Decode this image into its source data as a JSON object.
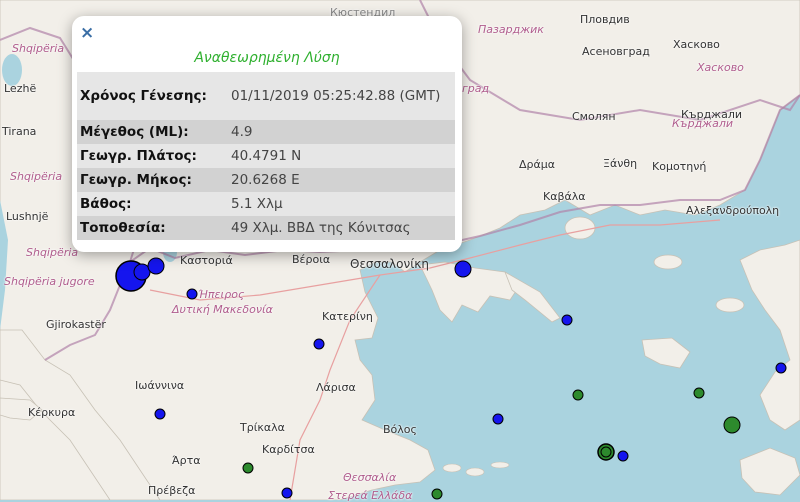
{
  "popup": {
    "close_glyph": "×",
    "title": "Αναθεωρημένη Λύση",
    "rows": [
      {
        "key": "Χρόνος Γένεσης:",
        "value": "01/11/2019 05:25:42.88 (GMT)"
      },
      {
        "key": "Μέγεθος (ML):",
        "value": "4.9"
      },
      {
        "key": "Γεωγρ. Πλάτος:",
        "value": "40.4791 N"
      },
      {
        "key": "Γεωγρ. Μήκος:",
        "value": "20.6268 E"
      },
      {
        "key": "Βάθος:",
        "value": "5.1 Χλμ"
      },
      {
        "key": "Τοποθεσία:",
        "value": "49 Χλμ. ΒΒΔ της Κόνιτσας"
      }
    ]
  },
  "map_labels": [
    {
      "text": "Shqipëria",
      "kind": "region"
    },
    {
      "text": "Lezhë",
      "kind": "place"
    },
    {
      "text": "Tirana",
      "kind": "place"
    },
    {
      "text": "Shqipëria",
      "kind": "region"
    },
    {
      "text": "Lushnjë",
      "kind": "place"
    },
    {
      "text": "Shqipëria",
      "kind": "region"
    },
    {
      "text": "Shqipëria jugore",
      "kind": "region"
    },
    {
      "text": "Gjirokastër",
      "kind": "place"
    },
    {
      "text": "Κέρκυρα",
      "kind": "place"
    },
    {
      "text": "Ιωάννινα",
      "kind": "place"
    },
    {
      "text": "Άρτα",
      "kind": "place"
    },
    {
      "text": "Πρέβεζα",
      "kind": "place"
    },
    {
      "text": "Τρίκαλα",
      "kind": "place"
    },
    {
      "text": "Καρδίτσα",
      "kind": "place"
    },
    {
      "text": "Θεσσαλία",
      "kind": "region"
    },
    {
      "text": "Στερεά Ελλάδα",
      "kind": "region"
    },
    {
      "text": "Καστοριά",
      "kind": "place"
    },
    {
      "text": "Ήπειρος",
      "kind": "region"
    },
    {
      "text": "Δυτική Μακεδονία",
      "kind": "region"
    },
    {
      "text": "Βέροια",
      "kind": "place"
    },
    {
      "text": "Κατερίνη",
      "kind": "place"
    },
    {
      "text": "Λάρισα",
      "kind": "place"
    },
    {
      "text": "Βόλος",
      "kind": "place"
    },
    {
      "text": "Θεσσαλονίκη",
      "kind": "place"
    },
    {
      "text": "Кюстендил",
      "kind": "faint"
    },
    {
      "text": "Пловдив",
      "kind": "place"
    },
    {
      "text": "Хасково",
      "kind": "place"
    },
    {
      "text": "Пазарджик",
      "kind": "region"
    },
    {
      "text": "Асеновград",
      "kind": "place"
    },
    {
      "text": "Хасково",
      "kind": "region"
    },
    {
      "text": "Смолян",
      "kind": "place"
    },
    {
      "text": "Кърджали",
      "kind": "place"
    },
    {
      "text": "Кърджали",
      "kind": "region"
    },
    {
      "text": "град",
      "kind": "region"
    },
    {
      "text": "Δράμα",
      "kind": "place"
    },
    {
      "text": "Ξάνθη",
      "kind": "place"
    },
    {
      "text": "Κομοτηνή",
      "kind": "place"
    },
    {
      "text": "Καβάλα",
      "kind": "place"
    },
    {
      "text": "Αλεξανδρούπολη",
      "kind": "place"
    }
  ],
  "colors": {
    "sea": "#aad3df",
    "land": "#f2efe9",
    "border": "#b083a8",
    "blue_marker": "#1515ee",
    "green_marker": "#2d8a2d",
    "popup_title": "#2fb02f"
  },
  "markers": [
    {
      "color": "blue",
      "magnitude": "large"
    },
    {
      "color": "blue",
      "magnitude": "medium"
    },
    {
      "color": "blue",
      "magnitude": "small"
    },
    {
      "color": "blue",
      "magnitude": "small"
    },
    {
      "color": "blue",
      "magnitude": "medium"
    },
    {
      "color": "blue",
      "magnitude": "small"
    },
    {
      "color": "blue",
      "magnitude": "small"
    },
    {
      "color": "blue",
      "magnitude": "small"
    },
    {
      "color": "blue",
      "magnitude": "small"
    },
    {
      "color": "blue",
      "magnitude": "small"
    },
    {
      "color": "blue",
      "magnitude": "small"
    },
    {
      "color": "green",
      "magnitude": "small"
    },
    {
      "color": "green",
      "magnitude": "small"
    },
    {
      "color": "green",
      "magnitude": "small"
    },
    {
      "color": "green",
      "magnitude": "medium"
    },
    {
      "color": "green",
      "magnitude": "medium"
    },
    {
      "color": "green",
      "magnitude": "small"
    },
    {
      "color": "green",
      "magnitude": "small"
    }
  ]
}
